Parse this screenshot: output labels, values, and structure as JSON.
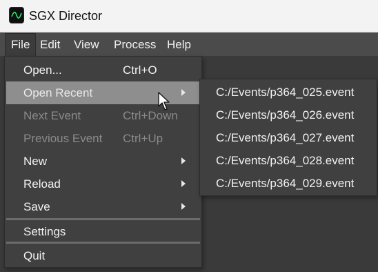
{
  "window": {
    "title": "SGX Director",
    "icon": "sine-wave-icon"
  },
  "menubar": {
    "items": [
      {
        "label": "File"
      },
      {
        "label": "Edit"
      },
      {
        "label": "View"
      },
      {
        "label": "Process"
      },
      {
        "label": "Help"
      }
    ]
  },
  "file_menu": {
    "items": [
      {
        "label": "Open...",
        "shortcut": "Ctrl+O",
        "enabled": true
      },
      {
        "label": "Open Recent",
        "has_submenu": true,
        "highlighted": true
      },
      {
        "label": "Next Event",
        "shortcut": "Ctrl+Down",
        "enabled": false
      },
      {
        "label": "Previous Event",
        "shortcut": "Ctrl+Up",
        "enabled": false
      },
      {
        "label": "New",
        "has_submenu": true
      },
      {
        "label": "Reload",
        "has_submenu": true
      },
      {
        "label": "Save",
        "has_submenu": true
      },
      {
        "label": "Settings"
      },
      {
        "label": "Quit"
      }
    ]
  },
  "recent_submenu": {
    "items": [
      "C:/Events/p364_025.event",
      "C:/Events/p364_026.event",
      "C:/Events/p364_027.event",
      "C:/Events/p364_028.event",
      "C:/Events/p364_029.event"
    ]
  },
  "colors": {
    "menubar_bg": "#4b4b4b",
    "menu_bg": "#404040",
    "highlight_bg": "#8e8e8e",
    "disabled_text": "#8a8a8a"
  }
}
